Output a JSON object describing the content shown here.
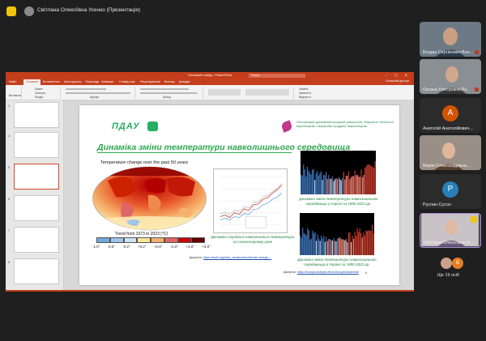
{
  "meeting": {
    "presenter_title": "Світлана Олексіївна Усенко (Презентація)"
  },
  "powerpoint": {
    "doc_title": "Головний слайд - PowerPoint",
    "search_placeholder": "Пошук",
    "window_controls": "– ▢ ✕",
    "tabs": [
      "Файл",
      "Основне",
      "Вставлення",
      "Конструктор",
      "Переходи",
      "Анімація",
      "Слайд-шоу",
      "Рецензування",
      "Вигляд",
      "Довідка"
    ],
    "share_label": "Спільний доступ",
    "ribbon_buttons": [
      "Вставити",
      "Макет",
      "Скинути",
      "Розділ",
      "Шрифт",
      "Абзац",
      "Знайти",
      "Замінити",
      "Виділити"
    ]
  },
  "slide": {
    "logo_text": "ПДАУ",
    "university_name": "Полтавський державний аграрний університет. Факультет технології виробництва і переробки продукції тваринництва",
    "title": "Динаміка зміни температури навколишнього середовища",
    "map_title": "Temperature change over the past 50 years",
    "map_caption": "Trend from 1973 to 2023 (°C)",
    "legend_ticks": [
      "-1.0°",
      "-0.5°",
      "-0.2°",
      "+0.2°",
      "+0.5°",
      "+1.0°",
      "+2.0°",
      "+4.0°"
    ],
    "legend_colors": [
      "#6fa8dc",
      "#9fc5e8",
      "#cfe2f3",
      "#ffe599",
      "#f6b26b",
      "#e06666",
      "#cc0000",
      "#660000"
    ],
    "chart_caption": "Динаміка середньої навколишньої температури на планетарному рівні",
    "stripes1_caption": "Динаміка зміни температури навколишнього середовища у Європі за 1850-2022 рр.",
    "stripes2_caption": "Динаміка зміни температури навколишнього середовища в Україні за 1850-2022 рр.",
    "source1_label": "Джерело:",
    "source1_url": "https://earth.org/data_visualization/climate-change-...",
    "source2_label": "Джерело:",
    "source2_url": "https://showyourstripes.info/c/europe/ukraine/all",
    "page_number": "6"
  },
  "participants": [
    {
      "name": "Богдан Сергійович Вол...",
      "type": "video"
    },
    {
      "name": "Оксана Григорівна Ру...",
      "type": "video"
    },
    {
      "name": "Анатолій Анатолійович...",
      "type": "avatar",
      "initial": "A",
      "color": "#d35400"
    },
    {
      "name": "Марія Олександрівна...",
      "type": "video"
    },
    {
      "name": "Руслан Сусол",
      "type": "avatar",
      "initial": "P",
      "color": "#2980b9"
    },
    {
      "name": "Світлана Олексіївна Ус...",
      "type": "video"
    }
  ],
  "more_participants": {
    "label": "Ще 19 осіб",
    "initial": "В"
  }
}
